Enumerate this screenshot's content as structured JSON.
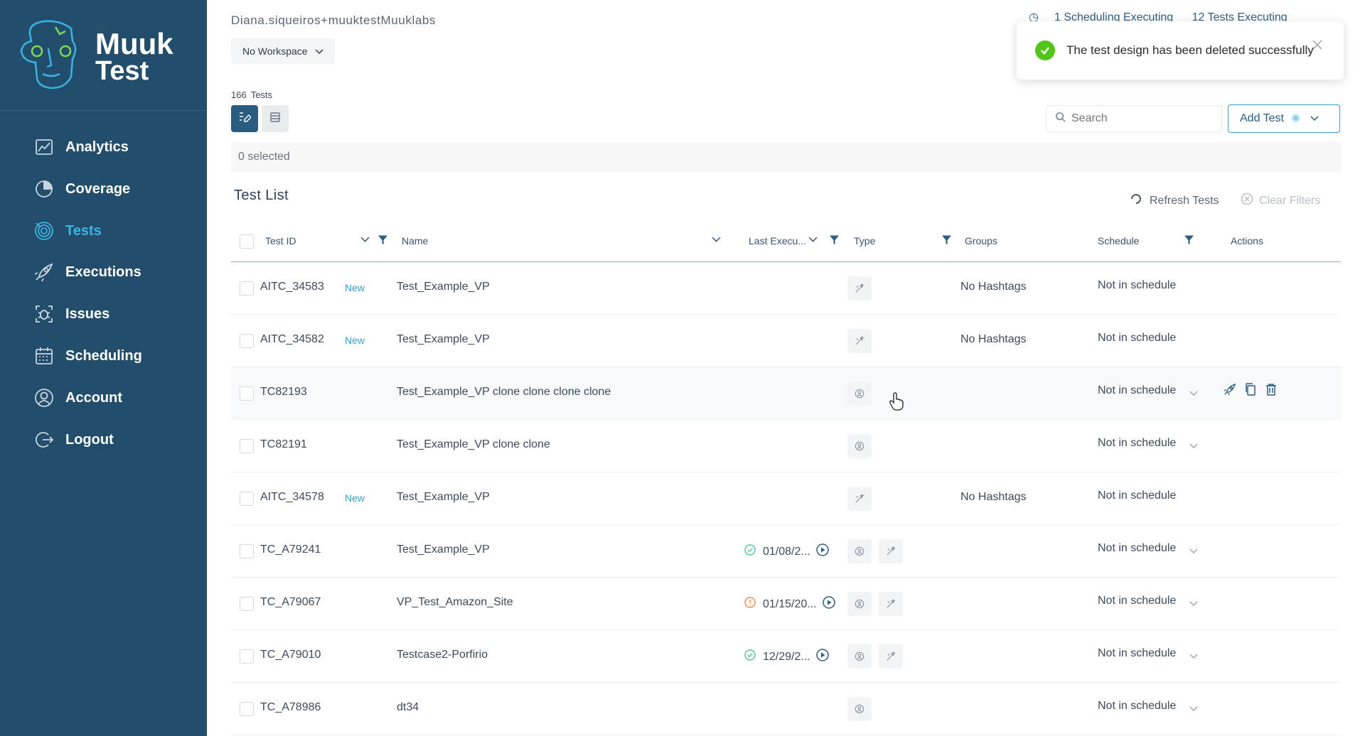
{
  "app": {
    "brand_line1": "Muuk",
    "brand_line2": "Test",
    "brand_color": "#234e6b",
    "accent_color": "#3bb3e4"
  },
  "sidebar": {
    "items": [
      {
        "label": "Analytics",
        "icon": "analytics-icon",
        "active": false
      },
      {
        "label": "Coverage",
        "icon": "coverage-icon",
        "active": false
      },
      {
        "label": "Tests",
        "icon": "tests-icon",
        "active": true
      },
      {
        "label": "Executions",
        "icon": "rocket-icon",
        "active": false
      },
      {
        "label": "Issues",
        "icon": "bug-icon",
        "active": false
      },
      {
        "label": "Scheduling",
        "icon": "calendar-icon",
        "active": false
      },
      {
        "label": "Account",
        "icon": "user-icon",
        "active": false
      },
      {
        "label": "Logout",
        "icon": "logout-icon",
        "active": false
      }
    ]
  },
  "header": {
    "user": "Diana.siqueiros+muuktestMuuklabs",
    "workspace": "No Workspace",
    "scheduling_status": "1 Scheduling Executing",
    "tests_status": "12 Tests Executing"
  },
  "toolbar": {
    "count": "166",
    "count_label": "Tests",
    "search_placeholder": "Search",
    "add_test_label": "Add Test",
    "selected_text": "0 selected"
  },
  "list": {
    "title": "Test List",
    "refresh_label": "Refresh Tests",
    "clear_filters_label": "Clear Filters",
    "columns": {
      "test_id": "Test ID",
      "name": "Name",
      "last_execution": "Last Execu...",
      "type": "Type",
      "groups": "Groups",
      "schedule": "Schedule",
      "actions": "Actions"
    },
    "rows": [
      {
        "id": "AITC_34583",
        "badge": "New",
        "name": "Test_Example_VP",
        "exec_date": "",
        "exec_status": "",
        "types": [
          "ai"
        ],
        "groups": "No Hashtags",
        "schedule": "Not in schedule",
        "schedule_dropdown": false
      },
      {
        "id": "AITC_34582",
        "badge": "New",
        "name": "Test_Example_VP",
        "exec_date": "",
        "exec_status": "",
        "types": [
          "ai"
        ],
        "groups": "No Hashtags",
        "schedule": "Not in schedule",
        "schedule_dropdown": false
      },
      {
        "id": "TC82193",
        "badge": "",
        "name": "Test_Example_VP clone clone clone clone",
        "exec_date": "",
        "exec_status": "",
        "types": [
          "recorded"
        ],
        "groups": "",
        "schedule": "Not in schedule",
        "schedule_dropdown": true,
        "actions": true
      },
      {
        "id": "TC82191",
        "badge": "",
        "name": "Test_Example_VP clone clone",
        "exec_date": "",
        "exec_status": "",
        "types": [
          "recorded"
        ],
        "groups": "",
        "schedule": "Not in schedule",
        "schedule_dropdown": true
      },
      {
        "id": "AITC_34578",
        "badge": "New",
        "name": "Test_Example_VP",
        "exec_date": "",
        "exec_status": "",
        "types": [
          "ai"
        ],
        "groups": "No Hashtags",
        "schedule": "Not in schedule",
        "schedule_dropdown": false
      },
      {
        "id": "TC_A79241",
        "badge": "",
        "name": "Test_Example_VP",
        "exec_date": "01/08/2...",
        "exec_status": "passed",
        "types": [
          "recorded",
          "ai"
        ],
        "groups": "",
        "schedule": "Not in schedule",
        "schedule_dropdown": true
      },
      {
        "id": "TC_A79067",
        "badge": "",
        "name": "VP_Test_Amazon_Site",
        "exec_date": "01/15/20...",
        "exec_status": "failed",
        "types": [
          "recorded",
          "ai"
        ],
        "groups": "",
        "schedule": "Not in schedule",
        "schedule_dropdown": true
      },
      {
        "id": "TC_A79010",
        "badge": "",
        "name": "Testcase2-Porfirio",
        "exec_date": "12/29/2...",
        "exec_status": "passed",
        "types": [
          "recorded",
          "ai"
        ],
        "groups": "",
        "schedule": "Not in schedule",
        "schedule_dropdown": true
      },
      {
        "id": "TC_A78986",
        "badge": "",
        "name": "dt34",
        "exec_date": "",
        "exec_status": "",
        "types": [
          "recorded"
        ],
        "groups": "",
        "schedule": "Not in schedule",
        "schedule_dropdown": true
      }
    ]
  },
  "toast": {
    "message": "The test design has been deleted successfully"
  }
}
